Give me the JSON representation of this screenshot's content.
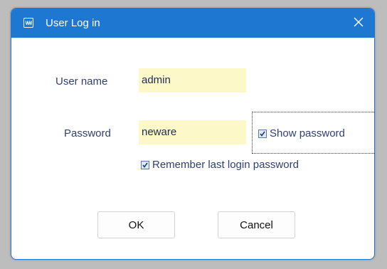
{
  "window": {
    "title": "User Log in",
    "icon": "app-logo-icon",
    "close_icon": "close-icon"
  },
  "form": {
    "username_label": "User name",
    "username_value": "admin",
    "password_label": "Password",
    "password_value": "neware",
    "show_password": {
      "label": "Show password",
      "checked": true
    },
    "remember_password": {
      "label": "Remember last login password",
      "checked": true
    }
  },
  "buttons": {
    "ok_label": "OK",
    "cancel_label": "Cancel"
  },
  "colors": {
    "titlebar": "#1e78d2",
    "field_background": "#fdf8c8",
    "label_text": "#2f3f73"
  }
}
